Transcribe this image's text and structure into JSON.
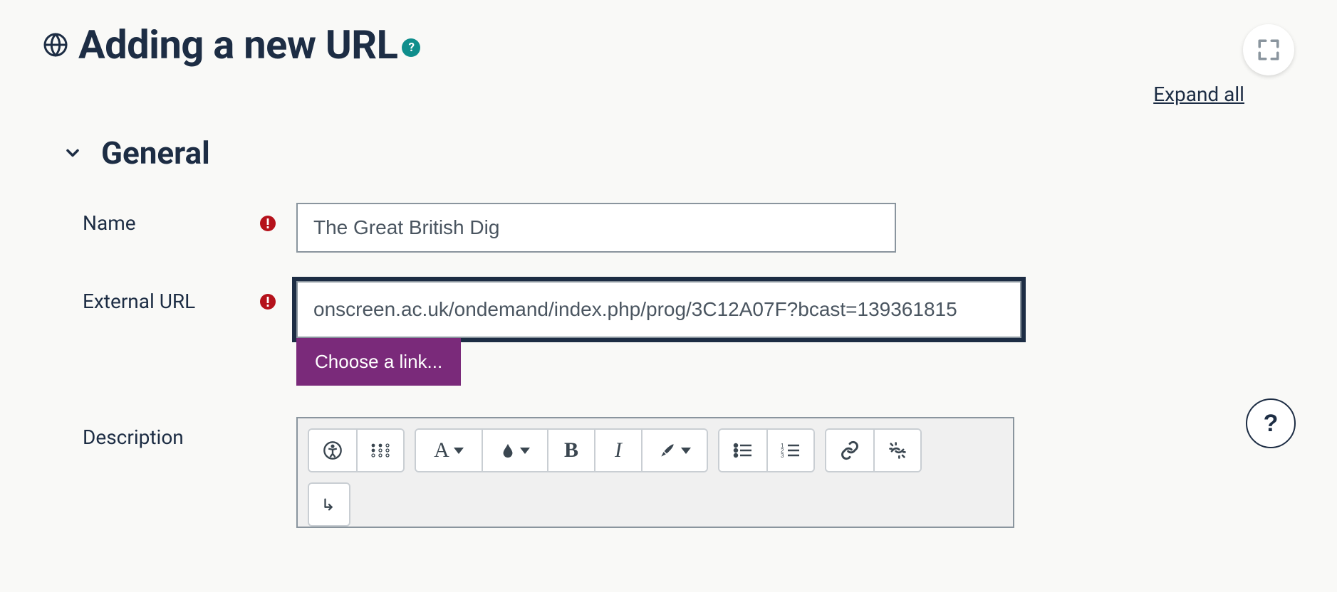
{
  "header": {
    "title": "Adding a new URL",
    "expand_all": "Expand all"
  },
  "section": {
    "general_label": "General"
  },
  "fields": {
    "name": {
      "label": "Name",
      "value": "The Great British Dig"
    },
    "external_url": {
      "label": "External URL",
      "value": "onscreen.ac.uk/ondemand/index.php/prog/3C12A07F?bcast=139361815",
      "choose_link": "Choose a link..."
    },
    "description": {
      "label": "Description"
    }
  },
  "floating_help": "?"
}
